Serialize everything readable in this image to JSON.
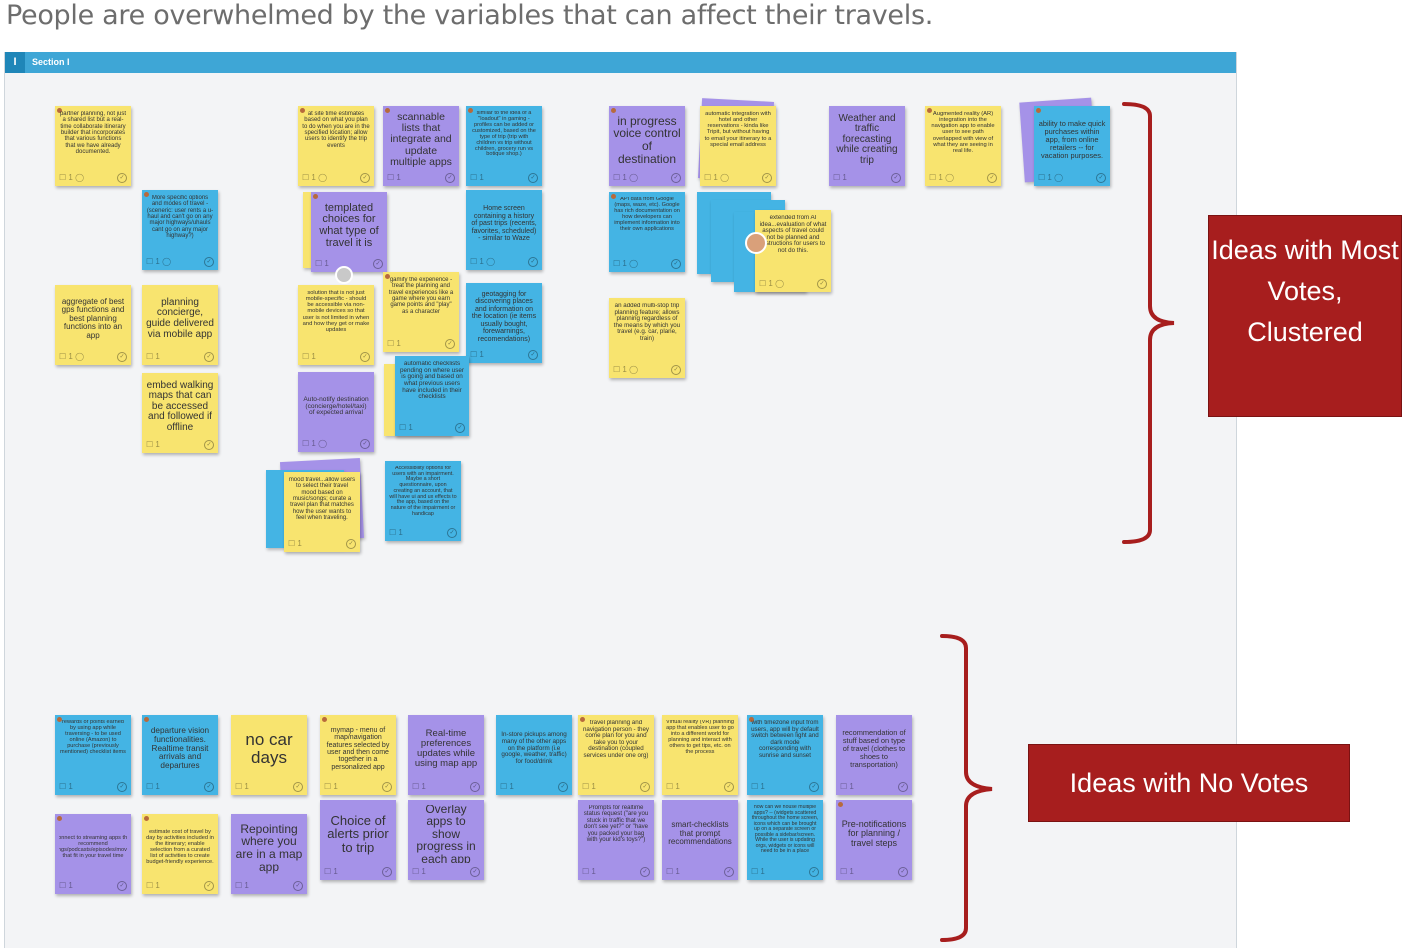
{
  "headline": "People are overwhelmed by the variables that can affect their travels.",
  "section": {
    "handle": "I",
    "title": "Section I"
  },
  "colors": {
    "yellow": "#f8e46f",
    "blue": "#44b4e4",
    "purple": "#a592e8",
    "section_bar": "#3ea6d6",
    "callout": "#a71e1e"
  },
  "annotations": {
    "most_votes": "Ideas with Most Votes, Clustered",
    "no_votes": "Ideas with No Votes"
  },
  "notes": [
    {
      "text": "partner planning, not just a shared list but a real-time collaborate itinerary builder that incorporates that various functions that we have already documented.",
      "foot": "☐ 1 ◯"
    },
    {
      "text": "More specific options and modes of travel - (sceneric: user rents a u-haul and can't go on any major highways/uhauls cant go on any major highway?)",
      "foot": "☐ 1 ◯"
    },
    {
      "text": "aggregate of best gps functions and best planning functions into an app",
      "foot": "☐ 1 ◯"
    },
    {
      "text": "planning concierge, guide delivered via mobile app",
      "foot": "☐ 1"
    },
    {
      "text": "embed walking maps that can be accessed and followed if offline",
      "foot": "☐ 1"
    },
    {
      "text": "at site time estimates based on what you plan to do when you are in the specified location; allow users to identify the trip events",
      "foot": "☐ 1 ◯"
    },
    {
      "text": "scannable lists that integrate and update multiple apps",
      "foot": "☐ 1"
    },
    {
      "text": "similar to the idea of a \"loadout\" in gaming - profiles can be added or customized, based on the type of trip (trip with children vs trip without children, grocery run vs botique shop.)",
      "foot": "☐ 1"
    },
    {
      "text": "templated choices for what type of travel it is",
      "foot": "☐ 1"
    },
    {
      "text": "Home screen containing a history of past trips (recents, favorites, scheduled) - similar to Waze",
      "foot": "☐ 1 ◯"
    },
    {
      "text": "solution that is not just mobile-specific - should be accessible via non-mobile devices so that user is not limited in when and how they get or make updates",
      "foot": "☐ 1"
    },
    {
      "text": "gamify the experience - treat the planning and travel experiences like a game where you earn game points and \"play\" as a character",
      "foot": "☐ 1"
    },
    {
      "text": "geotagging for discovering places and information on the location (ie items usually bought, forewarnings, recomendations)",
      "foot": "☐ 1"
    },
    {
      "text": "automatic checklists pending on where user is going and based on what previous users have included in their checklists",
      "foot": "☐ 1"
    },
    {
      "text": "Auto-notify destination (concierge/hotel/taxi) of expected arrival",
      "foot": "☐ 1 ◯"
    },
    {
      "text": "mood travel...allow users to select their travel mood based on music/songs; curate a travel plan that matches how the user wants to feel when traveling.",
      "foot": "☐ 1"
    },
    {
      "text": "Accessibility options for users with an impairment. Maybe a short questionnaire, upon creating an account, that will have ui and ux effects to the app, based on the nature of the impairment or handicap",
      "foot": "☐ 1"
    },
    {
      "text": "in progress voice control of destination",
      "foot": "☐ 1 ◯"
    },
    {
      "text": "automatic integration with hotel and other reservations - kinda like Tripit, but without having to email your itinerary to a special email address",
      "foot": "☐ 1 ◯"
    },
    {
      "text": "Weather and traffic forecasting while creating trip",
      "foot": "☐ 1"
    },
    {
      "text": "Augmented reality (AR) integration into the navigation app to enable user to see path overlapped with view of what they are seeing in real life.",
      "foot": "☐ 1 ◯"
    },
    {
      "text": "ability to make quick purchases within app, from online retailers -- for vacation purposes.",
      "foot": "☐ 1 ◯"
    },
    {
      "text": "API data from Google (maps, waze, etc). Google has rich documentation on how developers can implement information into their own applications",
      "foot": "☐ 1 ◯"
    },
    {
      "text": "extended from AI idea...evaluation of what aspects of travel could not be planned and instructions for users to not do this.",
      "foot": "☐ 1 ◯"
    },
    {
      "text": "an added multi-stop trip planning feature; allows planning regardless of the means by which you travel (e.g. car, plane, train)",
      "foot": "☐ 1 ◯"
    },
    {
      "text": "rewards or points earned by using app while traversing - to be used online (Amazon) to purchase (previously mentioned) checklist items",
      "foot": "☐ 1"
    },
    {
      "text": "departure vision functionalities. Realtime transit arrivals and departures",
      "foot": "☐ 1"
    },
    {
      "text": "no car days",
      "foot": "☐ 1"
    },
    {
      "text": "mymap - menu of map/navigation features selected by user and then come together in a personalized app",
      "foot": "☐ 1"
    },
    {
      "text": "Real-time preferences updates while using map app",
      "foot": "☐ 1"
    },
    {
      "text": "In-store pickups among many of the other apps on the platform (i.e google, weather, traffic) for food/drink",
      "foot": "☐ 1"
    },
    {
      "text": "travel planning and navigation person - they come plan for you and take you to your destination (coupled services under one org)",
      "foot": "☐ 1"
    },
    {
      "text": "Virtual reality (VR) planning app that enables user to go into a different world for planning and interact with others to get tips, etc. on the process",
      "foot": "☐ 1"
    },
    {
      "text": "with timezone input from users, app will by default switch between light and dark mode corresponding with sunrise and sunset",
      "foot": "☐ 1"
    },
    {
      "text": "recommendation of stuff based on type of travel (clothes to shoes to transportation)",
      "foot": "☐ 1"
    },
    {
      "text": "Connect to streaming apps that recommend songs/podcasts/episodes/movies that fit in your travel time",
      "foot": "☐ 1"
    },
    {
      "text": "estimate cost of travel by day by activities included in the itinerary; enable selection from a curated list of activities to create budget-friendly experience.",
      "foot": "☐ 1"
    },
    {
      "text": "Repointing where you are in a map app",
      "foot": "☐ 1"
    },
    {
      "text": "Choice of alerts prior to trip",
      "foot": "☐ 1"
    },
    {
      "text": "Overlay apps to show progress in each app",
      "foot": "☐ 1"
    },
    {
      "text": "Prompts for realtime status request (\"are you stuck in traffic that we don't see yet?\" or \"have you packed your bag with your kid's toys?\")",
      "foot": "☐ 1"
    },
    {
      "text": "smart-checklists that prompt recommendations",
      "foot": "☐ 1"
    },
    {
      "text": "how can we house multiple apps? -- (widgets scattered throughout the home screen, icons which can be brought up on a separate screen or possible a sidebar/screen. While the user is updating orgs, widgets or icons will need to be in a place",
      "foot": "☐ 1"
    },
    {
      "text": "Pre-notifications for planning / travel steps",
      "foot": "☐ 1"
    }
  ]
}
